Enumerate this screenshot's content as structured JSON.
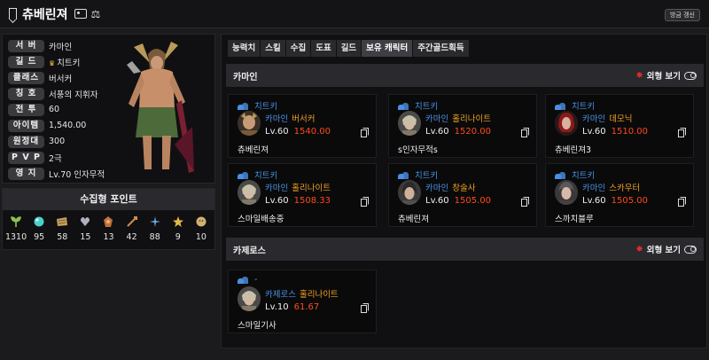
{
  "header": {
    "title": "츄베린져",
    "refresh_label": "방금 갱신",
    "icons": [
      "bookmark-icon",
      "id-card-icon",
      "scale-icon"
    ]
  },
  "profile": {
    "rows": [
      {
        "label": "서 버",
        "value": "카마인"
      },
      {
        "label": "길 드",
        "value": "치트키",
        "icon": "crown-icon"
      },
      {
        "label": "클래스",
        "value": "버서커"
      },
      {
        "label": "칭 호",
        "value": "서풍의 지휘자"
      },
      {
        "label": "전 투",
        "value": "60"
      },
      {
        "label": "아이템",
        "value": "1,540.00"
      },
      {
        "label": "원정대",
        "value": "300"
      },
      {
        "label": "P V P",
        "value": "2극"
      },
      {
        "label": "영 지",
        "value": "Lv.70 인자무적"
      }
    ]
  },
  "collection": {
    "title": "수집형 포인트",
    "items": [
      {
        "icon": "mokoko-seed-icon",
        "value": "1310",
        "color": "#8bc34a"
      },
      {
        "icon": "island-heart-icon",
        "value": "95",
        "color": "#4dd0c8"
      },
      {
        "icon": "art-icon",
        "value": "58",
        "color": "#c8a060"
      },
      {
        "icon": "giant-heart-icon",
        "value": "15",
        "color": "#b0b0c0"
      },
      {
        "icon": "ignea-token-icon",
        "value": "13",
        "color": "#c07040"
      },
      {
        "icon": "voyage-icon",
        "value": "42",
        "color": "#d09050"
      },
      {
        "icon": "worldtree-leaf-icon",
        "value": "88",
        "color": "#6fa8dc"
      },
      {
        "icon": "orpheus-star-icon",
        "value": "9",
        "color": "#e6b84a"
      },
      {
        "icon": "mokoko-icon",
        "value": "10",
        "color": "#d4b070"
      }
    ]
  },
  "tabs": [
    "능력치",
    "스킬",
    "수집",
    "도표",
    "길드",
    "보유 캐릭터",
    "주간골드획득"
  ],
  "active_tab": "보유 캐릭터",
  "view_label": "외형 보기",
  "servers": [
    {
      "name": "카마인",
      "characters": [
        {
          "guild": "치트키",
          "server": "카마인",
          "class": "버서커",
          "level": "Lv.60",
          "item_level": "1540.00",
          "name": "츄베린져"
        },
        {
          "guild": "치트키",
          "server": "카마인",
          "class": "홀리나이트",
          "level": "Lv.60",
          "item_level": "1520.00",
          "name": "s인자무적s"
        },
        {
          "guild": "치트키",
          "server": "카마인",
          "class": "데모닉",
          "level": "Lv.60",
          "item_level": "1510.00",
          "name": "츄베린져3"
        },
        {
          "guild": "치트키",
          "server": "카마인",
          "class": "홀리나이트",
          "level": "Lv.60",
          "item_level": "1508.33",
          "name": "스마일배송중"
        },
        {
          "guild": "치트키",
          "server": "카마인",
          "class": "창술사",
          "level": "Lv.60",
          "item_level": "1505.00",
          "name": "츄베린져"
        },
        {
          "guild": "치트키",
          "server": "카마인",
          "class": "스카우터",
          "level": "Lv.60",
          "item_level": "1505.00",
          "name": "스까치블루"
        }
      ]
    },
    {
      "name": "카제로스",
      "characters": [
        {
          "guild": "-",
          "server": "카제로스",
          "class": "홀리나이트",
          "level": "Lv.10",
          "item_level": "61.67",
          "name": "스마일기사"
        }
      ]
    }
  ]
}
